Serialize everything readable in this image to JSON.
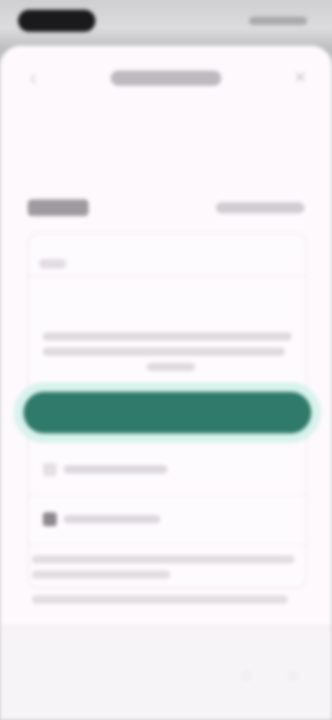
{
  "status_bar": {
    "time": "",
    "icons": [
      "signal-icon",
      "wifi-icon",
      "battery-icon"
    ]
  },
  "header": {
    "title": "",
    "back_icon": "‹",
    "close_icon": "×"
  },
  "section": {
    "title": "",
    "link": ""
  },
  "card": {
    "field_label": "",
    "notice_lines": [
      "",
      "",
      ""
    ],
    "primary_button": "",
    "options": [
      {
        "label": "",
        "icon": "▢"
      },
      {
        "label": "",
        "icon": "■"
      }
    ],
    "description_lines": [
      "",
      "",
      ""
    ]
  },
  "bottom_bar": {
    "icons": [
      "◌",
      "◌"
    ]
  },
  "colors": {
    "accent": "#2f7a6a",
    "accent_glow": "#d8f2ec",
    "sheet_background": "#fdf9fc"
  }
}
